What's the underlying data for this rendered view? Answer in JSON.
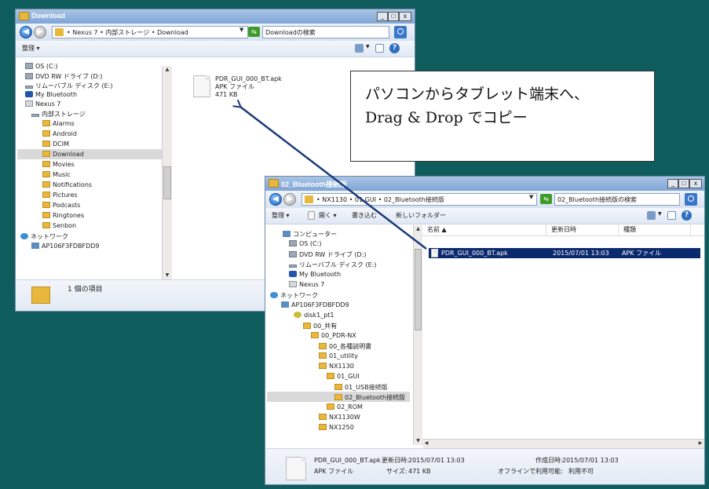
{
  "colors": {
    "desktop": "#0f5c5c",
    "selection": "#0b2a6e",
    "folder": "#e8b83c",
    "arrow": "#1a3a7a"
  },
  "win1": {
    "title": "Download",
    "controls": [
      "_",
      "□",
      "x"
    ],
    "breadcrumb": "• Nexus 7 • 内部ストレージ • Download",
    "search_placeholder": "Downloadの検索",
    "toolbar": {
      "organize": "整理 ▾"
    },
    "tree": [
      "OS (C:)",
      "DVD RW ドライブ (D:)",
      "リムーバブル ディスク (E:)",
      "My Bluetooth",
      "Nexus 7",
      "内部ストレージ",
      "Alarms",
      "Android",
      "DCIM",
      "Download",
      "Movies",
      "Music",
      "Notifications",
      "Pictures",
      "Podcasts",
      "Ringtones",
      "Senbon",
      "ネットワーク",
      "AP106F3FDBFDD9"
    ],
    "file": {
      "name": "PDR_GUI_000_BT.apk",
      "type": "APK ファイル",
      "size": "471 KB"
    },
    "status": "1 個の項目"
  },
  "win2": {
    "title": "02_Bluetooth接続版",
    "controls": [
      "_",
      "□",
      "x"
    ],
    "breadcrumb": "• NX1130 • 01 GUI • 02_Bluetooth接続版",
    "search_placeholder": "02_Bluetooth接続版の検索",
    "toolbar": {
      "organize": "整理 ▾",
      "open": "開く ▾",
      "write": "書き込む",
      "new_folder": "新しいフォルダー"
    },
    "tree": [
      "コンピューター",
      "OS (C:)",
      "DVD RW ドライブ (D:)",
      "リムーバブル ディスク (E:)",
      "My Bluetooth",
      "Nexus 7",
      "ネットワーク",
      "AP106F3FDBFDD9",
      "disk1_pt1",
      "00_共有",
      "00_PDR-NX",
      "00_各種説明書",
      "01_utility",
      "NX1130",
      "01_GUI",
      "01_USB接続版",
      "02_Bluetooth接続版",
      "02_ROM",
      "NX1130W",
      "NX1250"
    ],
    "columns": {
      "name": "名前 ▲",
      "date": "更新日時",
      "type": "種類"
    },
    "row": {
      "name": "PDR_GUI_000_BT.apk",
      "date": "2015/07/01 13:03",
      "type": "APK ファイル"
    },
    "details": {
      "name": "PDR_GUI_000_BT.apk",
      "modified_label": "更新日時:",
      "modified": "2015/07/01 13:03",
      "created_label": "作成日時:",
      "created": "2015/07/01 13:03",
      "type": "APK ファイル",
      "size_label": "サイズ:",
      "size": "471 KB",
      "offline_label": "オフラインで利用可能:",
      "offline": "利用不可"
    }
  },
  "callout": {
    "line1": "パソコンからタブレット端末へ、",
    "line2": "Drag & Drop でコピー"
  }
}
